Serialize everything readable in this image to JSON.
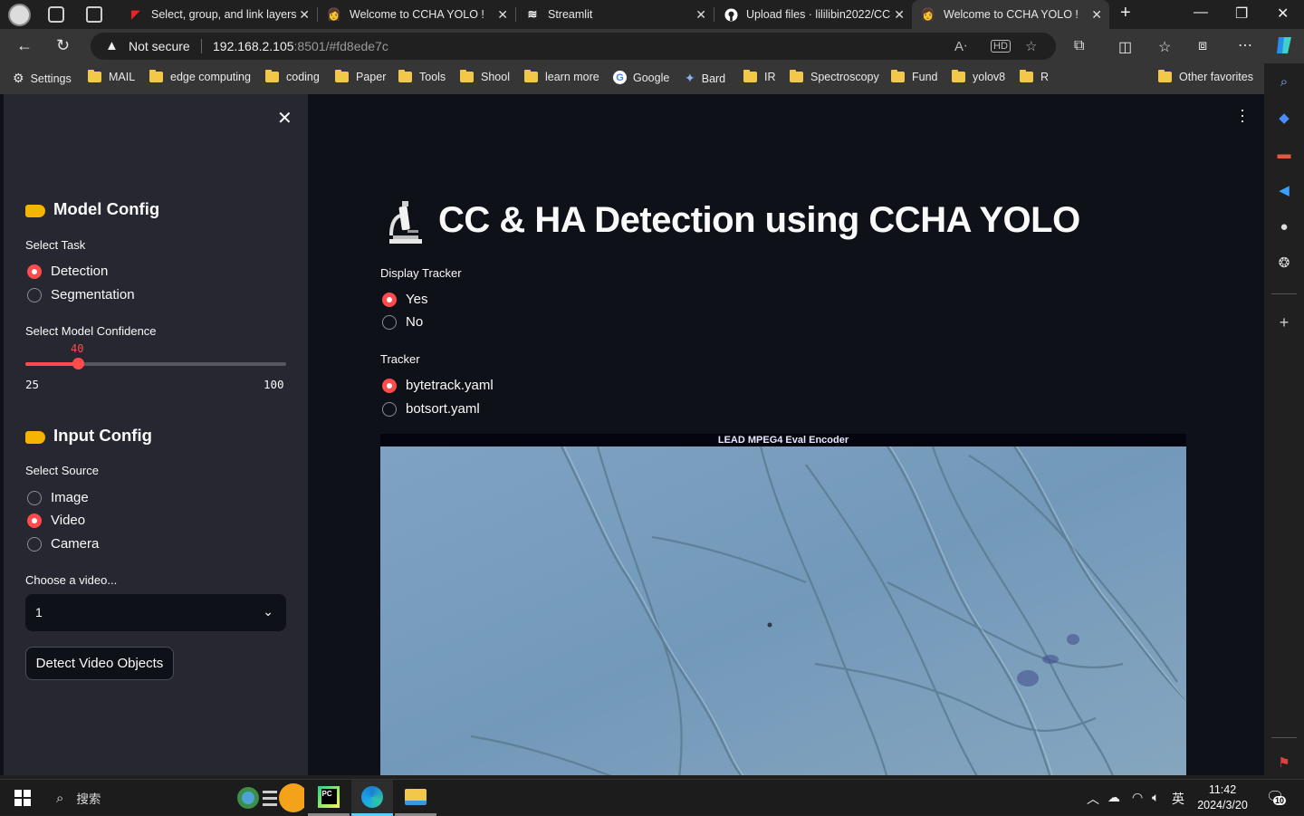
{
  "browser": {
    "tabs": [
      {
        "title": "Select, group, and link layers",
        "favicon": "adobe-icon"
      },
      {
        "title": "Welcome to CCHA YOLO !",
        "favicon": "yolo-avatar-icon"
      },
      {
        "title": "Streamlit",
        "favicon": "streamlit-icon"
      },
      {
        "title": "Upload files · lilili​bin2022/CC",
        "favicon": "github-icon"
      },
      {
        "title": "Welcome to CCHA YOLO !",
        "favicon": "yolo-avatar-icon",
        "active": true
      }
    ],
    "security_label": "Not secure",
    "url_host": "192.168.2.105",
    "url_rest": ":8501/#fd8ede7c"
  },
  "bookmarks": {
    "items": [
      "Settings",
      "MAIL",
      "edge computing",
      "coding",
      "Paper",
      "Tools",
      "Shool",
      "learn more",
      "Google",
      "Bard",
      "IR",
      "Spectroscopy",
      "Fund",
      "yolov8",
      "R"
    ],
    "other": "Other favorites"
  },
  "sidebar": {
    "model_config": {
      "heading": "Model Config",
      "task_label": "Select Task",
      "task_options": [
        "Detection",
        "Segmentation"
      ],
      "task_selected": "Detection",
      "confidence_label": "Select Model Confidence",
      "confidence_value": "40",
      "confidence_min": "25",
      "confidence_max": "100"
    },
    "input_config": {
      "heading": "Input Config",
      "source_label": "Select Source",
      "source_options": [
        "Image",
        "Video",
        "Camera"
      ],
      "source_selected": "Video",
      "video_label": "Choose a video...",
      "video_value": "1",
      "detect_button": "Detect Video Objects"
    }
  },
  "main": {
    "title": "CC & HA Detection using CCHA YOLO",
    "display_tracker_label": "Display Tracker",
    "tracker_display_options": [
      "Yes",
      "No"
    ],
    "tracker_display_selected": "Yes",
    "tracker_label": "Tracker",
    "tracker_options": [
      "bytetrack.yaml",
      "botsort.yaml"
    ],
    "tracker_selected": "bytetrack.yaml",
    "video_banner": "LEAD MPEG4 Eval Encoder"
  },
  "taskbar": {
    "search_placeholder": "搜索",
    "ime": "英",
    "time": "11:42",
    "date": "2024/3/20",
    "notifications": "10"
  },
  "colors": {
    "accent": "#ff4b4b",
    "sidebar_bg": "#262730",
    "main_bg": "#0e1117"
  }
}
